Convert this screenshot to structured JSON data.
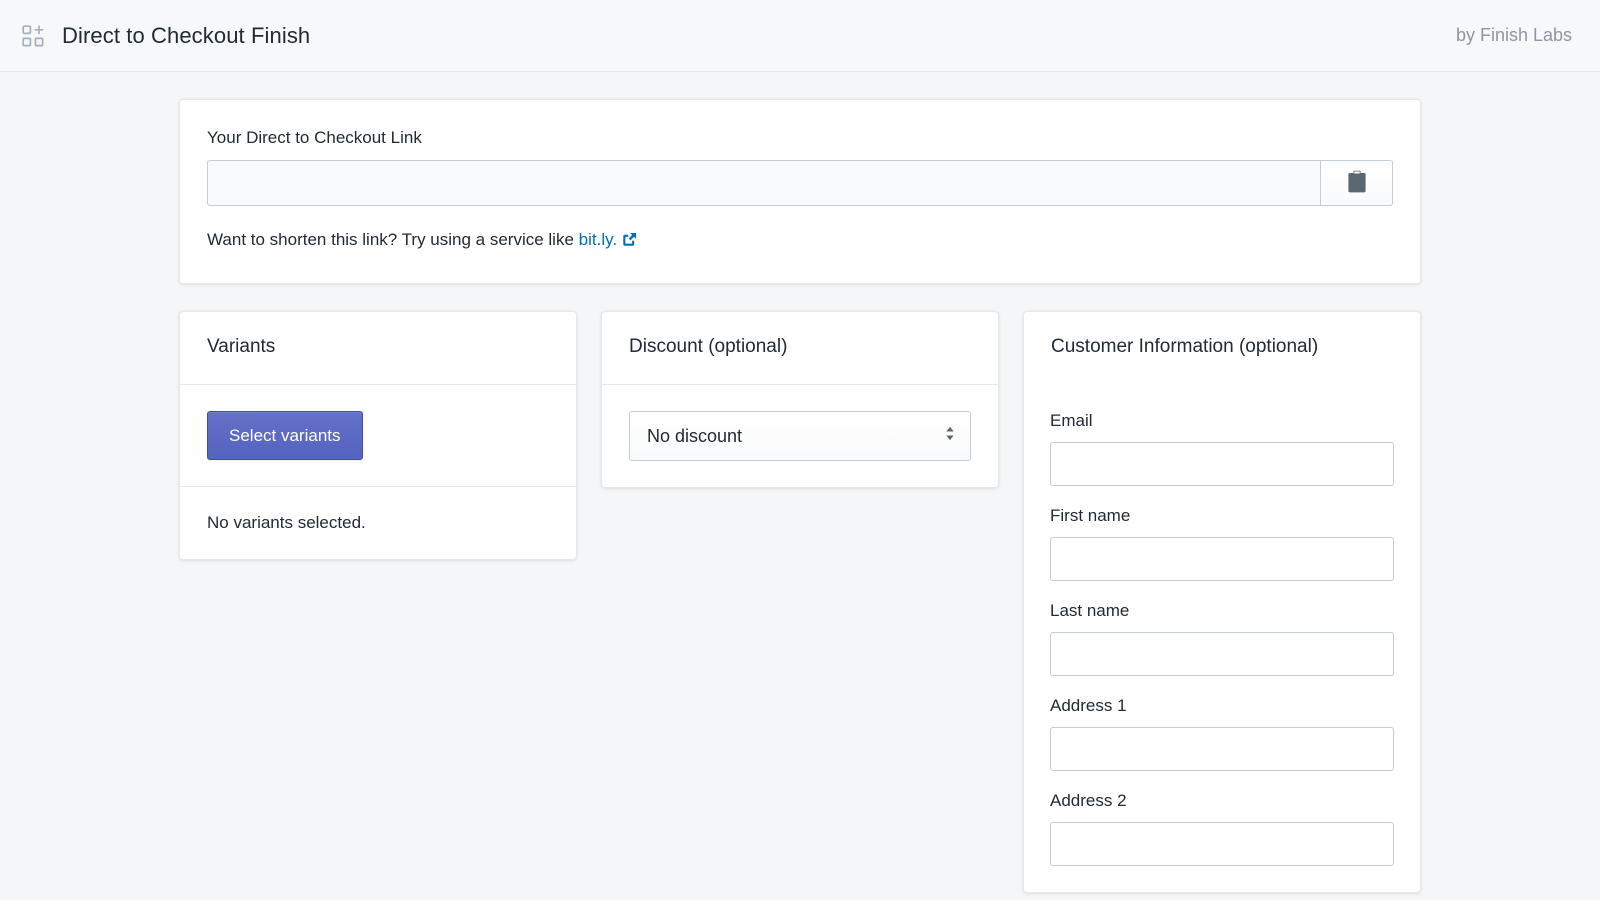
{
  "topbar": {
    "app_icon_name": "apps-add-icon",
    "title": "Direct to Checkout Finish",
    "attribution": "by Finish Labs"
  },
  "link_card": {
    "label": "Your Direct to Checkout Link",
    "input_value": "",
    "input_placeholder": "",
    "copy_button_label": "",
    "copy_icon_name": "clipboard-icon",
    "hint_prefix": "Want to shorten this link? Try using a service like ",
    "hint_link_text": "bit.ly.",
    "external_icon_name": "external-link-icon",
    "link_color": "#006fbb"
  },
  "variants_card": {
    "title": "Variants",
    "select_button_label": "Select variants",
    "empty_state": "No variants selected.",
    "primary_color": "#5c6ac4"
  },
  "discount_card": {
    "title": "Discount (optional)",
    "select_value": "No discount",
    "select_options": [
      "No discount"
    ],
    "caret_icon_name": "chevron-up-down-icon"
  },
  "customer_card": {
    "title": "Customer Information (optional)",
    "fields": [
      {
        "label": "Email",
        "value": "",
        "placeholder": ""
      },
      {
        "label": "First name",
        "value": "",
        "placeholder": ""
      },
      {
        "label": "Last name",
        "value": "",
        "placeholder": ""
      },
      {
        "label": "Address 1",
        "value": "",
        "placeholder": ""
      },
      {
        "label": "Address 2",
        "value": "",
        "placeholder": ""
      }
    ]
  }
}
